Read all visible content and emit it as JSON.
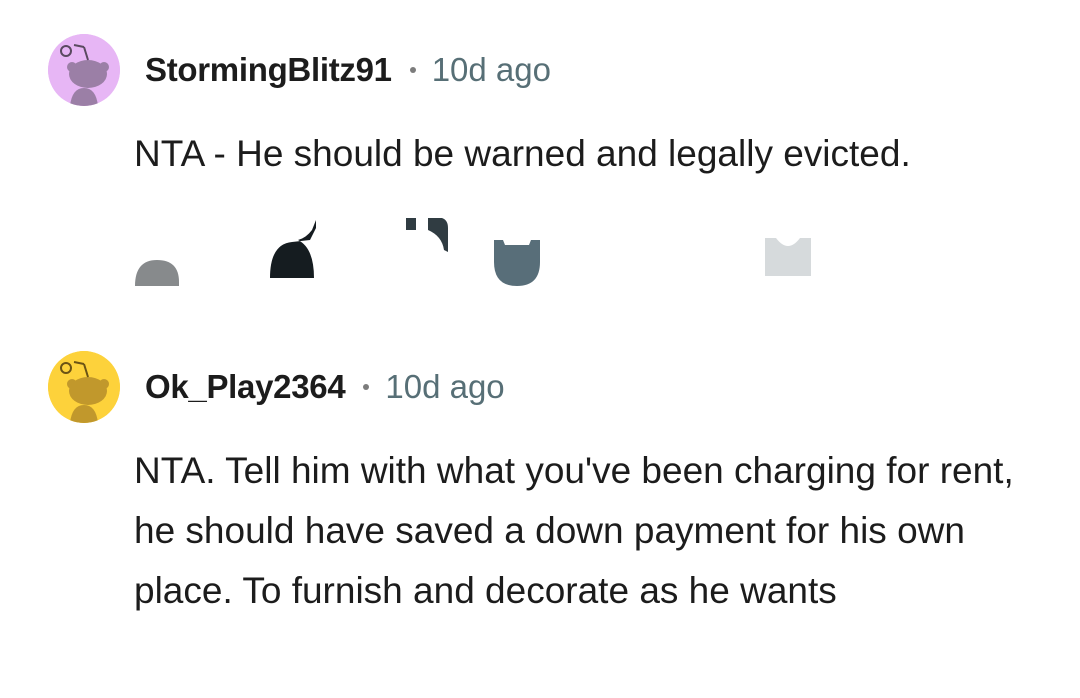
{
  "comments": [
    {
      "username": "StormingBlitz91",
      "time": "10d ago",
      "text": "NTA - He should be warned and legally evicted.",
      "avatar_color": "#e7b6f5",
      "avatar_fg": "#9b7fa6",
      "avatar_icon": "reddit-snoo-icon"
    },
    {
      "username": "Ok_Play2364",
      "time": "10d ago",
      "text": "NTA. Tell him with what you've been charging for rent, he should have saved a down payment for his own place. To furnish and decorate as he wants",
      "avatar_color": "#fdd23b",
      "avatar_fg": "#c1982c",
      "avatar_icon": "reddit-snoo-icon"
    }
  ],
  "actions": {
    "icons": [
      "upvote-icon",
      "downvote-icon",
      "reply-icon",
      "award-icon",
      "share-icon"
    ]
  }
}
